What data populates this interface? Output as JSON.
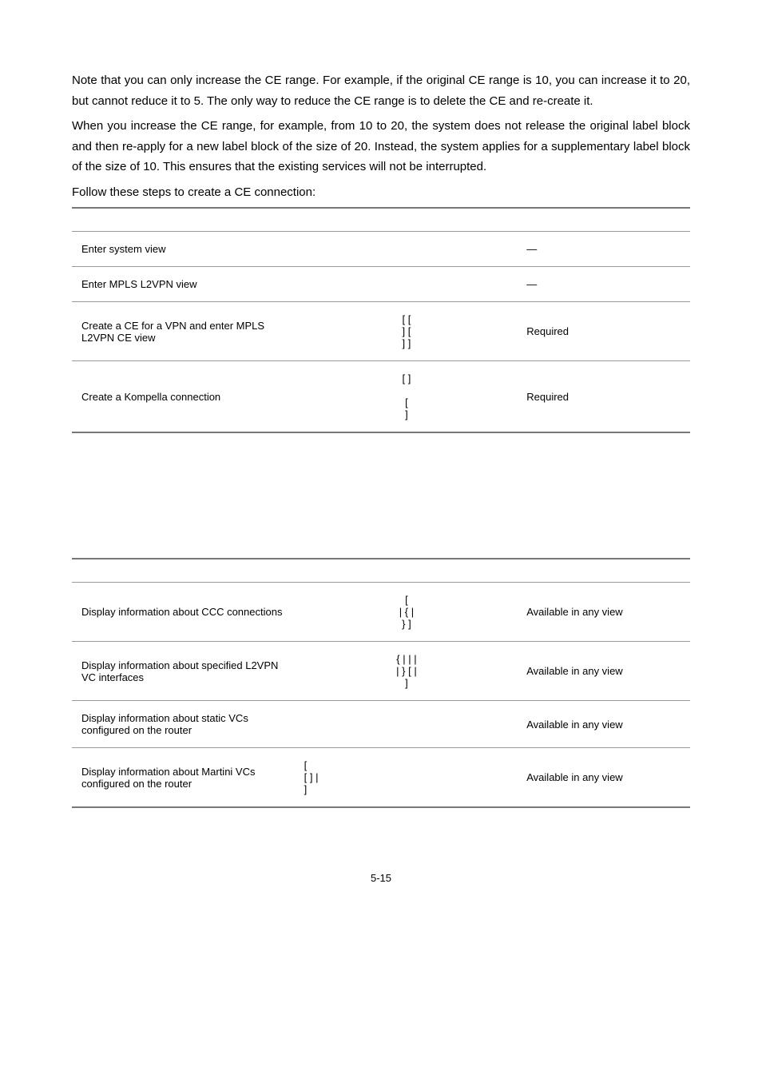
{
  "paragraphs": {
    "p1": "Note that you can only increase the CE range. For example, if the original CE range is 10, you can increase it to 20, but cannot reduce it to 5. The only way to reduce the CE range is to delete the CE and re-create it.",
    "p2": "When you increase the CE range, for example, from 10 to 20, the system does not release the original label block and then re-apply for a new label block of the size of 20. Instead, the system applies for a supplementary label block of the size of 10. This ensures that the existing services will not be interrupted.",
    "p3": "Follow these steps to create a CE connection:"
  },
  "table1": {
    "header": {
      "c1": "",
      "c2": "",
      "c3": ""
    },
    "rows": [
      {
        "c1": "Enter system view",
        "c2": "",
        "c3": "—"
      },
      {
        "c1": "Enter MPLS L2VPN view",
        "c2": "",
        "c3": "—"
      },
      {
        "c1": "Create a CE for a VPN and enter MPLS L2VPN CE view",
        "c2": "[        [\n] [\n] ]",
        "c3": "Required"
      },
      {
        "c1": "Create a Kompella connection",
        "c2": "[        ]\n\n[\n]",
        "c3": "Required"
      }
    ]
  },
  "table2": {
    "header": {
      "c1": "",
      "c2": "",
      "c3": ""
    },
    "rows": [
      {
        "c1": "Display information about CCC connections",
        "c2": "[\n|    {        |\n} ]",
        "c3": "Available in any view"
      },
      {
        "c1": "Display   information about specified L2VPN VC interfaces",
        "c2": "{    |        |    |\n|            } [    |\n]",
        "c3": "Available in any view"
      },
      {
        "c1": "Display information about static VCs configured on the router",
        "c2": "",
        "c3": "Available in any view"
      },
      {
        "c1": "Display information about Martini VCs configured on the router",
        "c2": "[\n[                                ] |\n]",
        "c3": "Available in any view"
      }
    ]
  },
  "footer": "5-15"
}
